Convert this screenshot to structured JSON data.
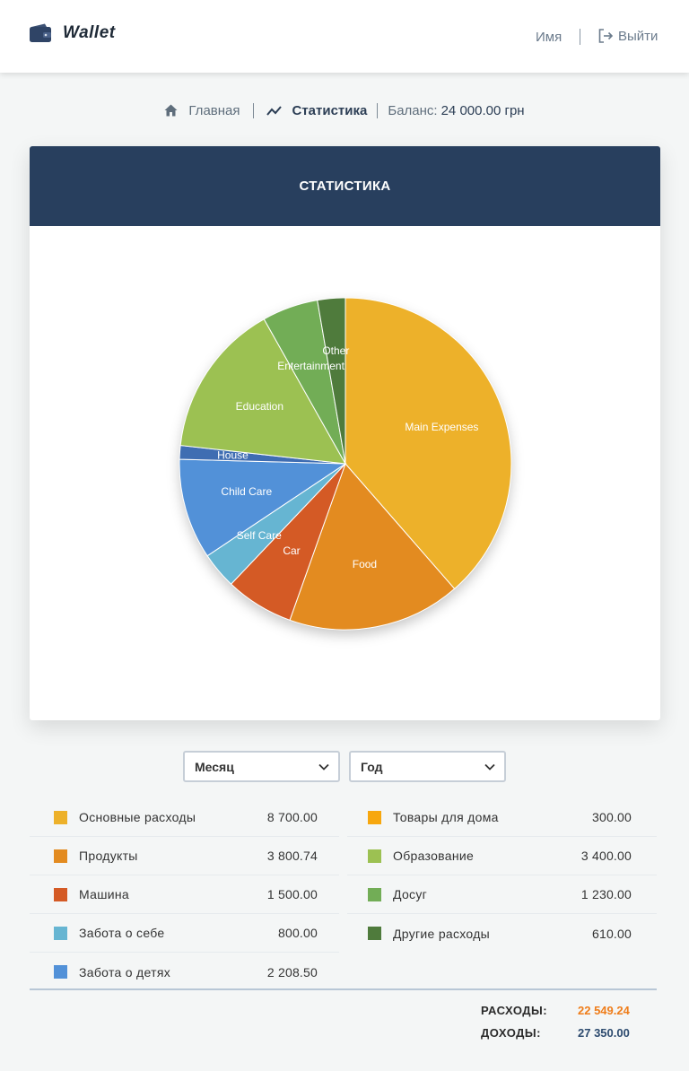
{
  "header": {
    "app_title": "Wallet",
    "user_name": "Имя",
    "logout_label": "Выйти"
  },
  "breadcrumb": {
    "home_label": "Главная",
    "stats_label": "Статистика",
    "balance_label": "Баланс:",
    "balance_value": "24 000.00 грн"
  },
  "card": {
    "title": "СТАТИСТИКА"
  },
  "filters": {
    "month_value": "Месяц",
    "year_value": "Год"
  },
  "legend": {
    "left": [
      {
        "label": "Основные расходы",
        "amount": "8 700.00",
        "color": "#edb12a"
      },
      {
        "label": "Продукты",
        "amount": "3 800.74",
        "color": "#e38b20"
      },
      {
        "label": "Машина",
        "amount": "1 500.00",
        "color": "#d45a25"
      },
      {
        "label": "Забота о себе",
        "amount": "800.00",
        "color": "#66b5d2"
      },
      {
        "label": "Забота о детях",
        "amount": "2 208.50",
        "color": "#5291d8"
      }
    ],
    "right": [
      {
        "label": "Товары для дома",
        "amount": "300.00",
        "color": "#f7a70e"
      },
      {
        "label": "Образование",
        "amount": "3 400.00",
        "color": "#9cc152"
      },
      {
        "label": "Досуг",
        "amount": "1 230.00",
        "color": "#72ad56"
      },
      {
        "label": "Другие расходы",
        "amount": "610.00",
        "color": "#4f7b3c"
      }
    ]
  },
  "totals": {
    "expenses_label": "РАСХОДЫ:",
    "expenses_value": "22 549.24",
    "income_label": "ДОХОДЫ:",
    "income_value": "27 350.00"
  },
  "chart_data": {
    "type": "pie",
    "categories": [
      "Main Expenses",
      "Food",
      "Car",
      "Self Care",
      "Child Care",
      "House",
      "Education",
      "Entertainment",
      "Other"
    ],
    "values": [
      8700,
      3800.74,
      1500,
      800,
      2208.5,
      300,
      3400,
      1230,
      610
    ],
    "colors": [
      "#edb12a",
      "#e38b20",
      "#d45a25",
      "#66b5d2",
      "#5291d8",
      "#3f6db2",
      "#9cc152",
      "#72ad56",
      "#4f7b3c"
    ],
    "start_angle": "top, clockwise"
  }
}
